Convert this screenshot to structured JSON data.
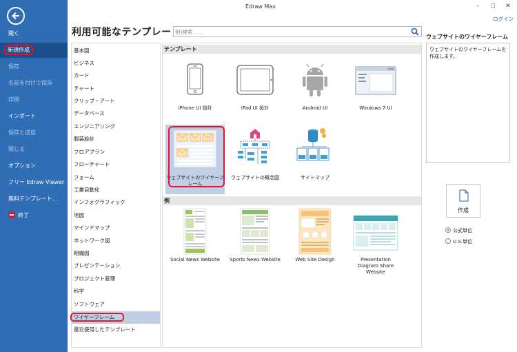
{
  "app": {
    "title": "Edraw Max",
    "login": "ログイン",
    "minimize": "–",
    "maximize": "☐",
    "close": "✕"
  },
  "nav": {
    "items": [
      {
        "label": "開く"
      },
      {
        "label": "新規作成"
      },
      {
        "label": "保存"
      },
      {
        "label": "名前を付けて保存"
      },
      {
        "label": "印刷"
      },
      {
        "label": "インポート"
      },
      {
        "label": "保存と送信"
      },
      {
        "label": "閉じる"
      },
      {
        "label": "オプション"
      },
      {
        "label": "フリー Edraw Viewer"
      },
      {
        "label": "無料テンプレート..."
      },
      {
        "label": "終了"
      }
    ]
  },
  "main": {
    "heading": "利用可能なテンプレート",
    "search_placeholder": "例)検索 . . .",
    "categories": [
      "基本図",
      "ビジネス",
      "カード",
      "チャート",
      "クリップ・アート",
      "データベース",
      "エンジニアリング",
      "服装設計",
      "フロアプラン",
      "フローチャート",
      "フォーム",
      "工業自動化",
      "インフォグラフィック",
      "地図",
      "マインドマップ",
      "ネットワーク図",
      "組織図",
      "プレゼンテーション",
      "プロジェクト管理",
      "科学",
      "ソフトウェア",
      "ワイヤーフレーム",
      "最近使用したテンプレート"
    ],
    "selected_category": "ワイヤーフレーム",
    "templates_header": "テンプレート",
    "examples_header": "例",
    "templates": [
      {
        "label": "iPhone UI 設計"
      },
      {
        "label": "iPad UI 設計"
      },
      {
        "label": "Android UI"
      },
      {
        "label": "Windows 7 UI"
      },
      {
        "label": "ウェブサイトのワイヤーフレーム"
      },
      {
        "label": "ウェブサイトの概念図"
      },
      {
        "label": "サイトマップ"
      }
    ],
    "selected_template": "ウェブサイトのワイヤーフレーム",
    "examples": [
      {
        "label": "Social News Website"
      },
      {
        "label": "Sports News Website"
      },
      {
        "label": "Web Site Design"
      },
      {
        "label": "Presentation Diagram Share Website"
      }
    ]
  },
  "details": {
    "title": "ウェブサイトのワイヤーフレーム",
    "description": "ウェブサイトのワイヤーフレームを作成します。",
    "create_label": "作成",
    "units": [
      {
        "label": "公式単位",
        "selected": true
      },
      {
        "label": "U.S.単位",
        "selected": false
      }
    ]
  },
  "colors": {
    "nav_bg": "#2f6db5",
    "nav_active": "#1d4f8c",
    "selected_bg": "#c2cde6",
    "highlight_red": "#e0142b"
  }
}
